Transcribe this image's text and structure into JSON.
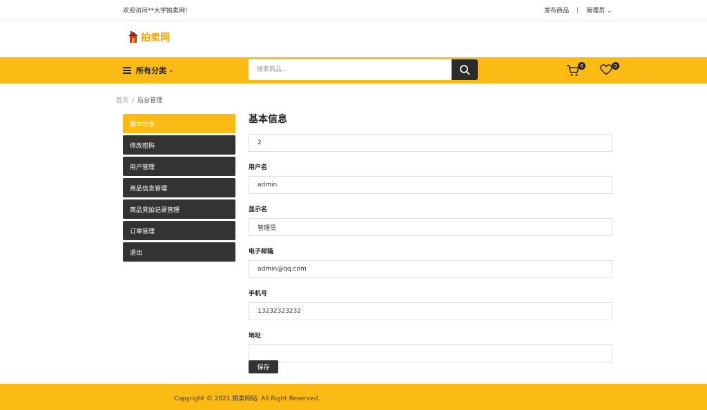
{
  "topbar": {
    "welcome": "欢迎访问**大学拍卖网!",
    "publish": "发布商品",
    "separator": "|",
    "user": "管理员",
    "chevron": "⌄"
  },
  "logo": {
    "text": "拍卖网"
  },
  "nav": {
    "categories_label": "所有分类",
    "categories_chevron": "⌄",
    "search_placeholder": "搜索商品...",
    "cart_count": "0",
    "wishlist_count": "0"
  },
  "breadcrumb": {
    "home": "首页",
    "divider": "/",
    "current": "后台管理"
  },
  "sidebar": {
    "items": [
      {
        "label": "基本信息",
        "active": true
      },
      {
        "label": "修改密码"
      },
      {
        "label": "用户管理"
      },
      {
        "label": "商品信息管理"
      },
      {
        "label": "商品竞拍记录管理"
      },
      {
        "label": "订单管理"
      },
      {
        "label": "退出"
      }
    ]
  },
  "form": {
    "title": "基本信息",
    "id_value": "2",
    "username_label": "用户名",
    "username_value": "admin",
    "display_label": "显示名",
    "display_value": "管理员",
    "email_label": "电子邮箱",
    "email_value": "admin@qq.com",
    "phone_label": "手机号",
    "phone_value": "13232323232",
    "address_label": "地址",
    "address_value": "",
    "save_label": "保存"
  },
  "footer": {
    "copyright": "Copyright © 2021 拍卖网站. All Right Reserved."
  },
  "colors": {
    "accent": "#fbbb14",
    "dark": "#333333"
  },
  "icons": {
    "menu": "hamburger-menu-icon",
    "search": "search-icon",
    "cart": "cart-icon",
    "wishlist": "heart-icon",
    "logo": "house-logo-icon"
  }
}
